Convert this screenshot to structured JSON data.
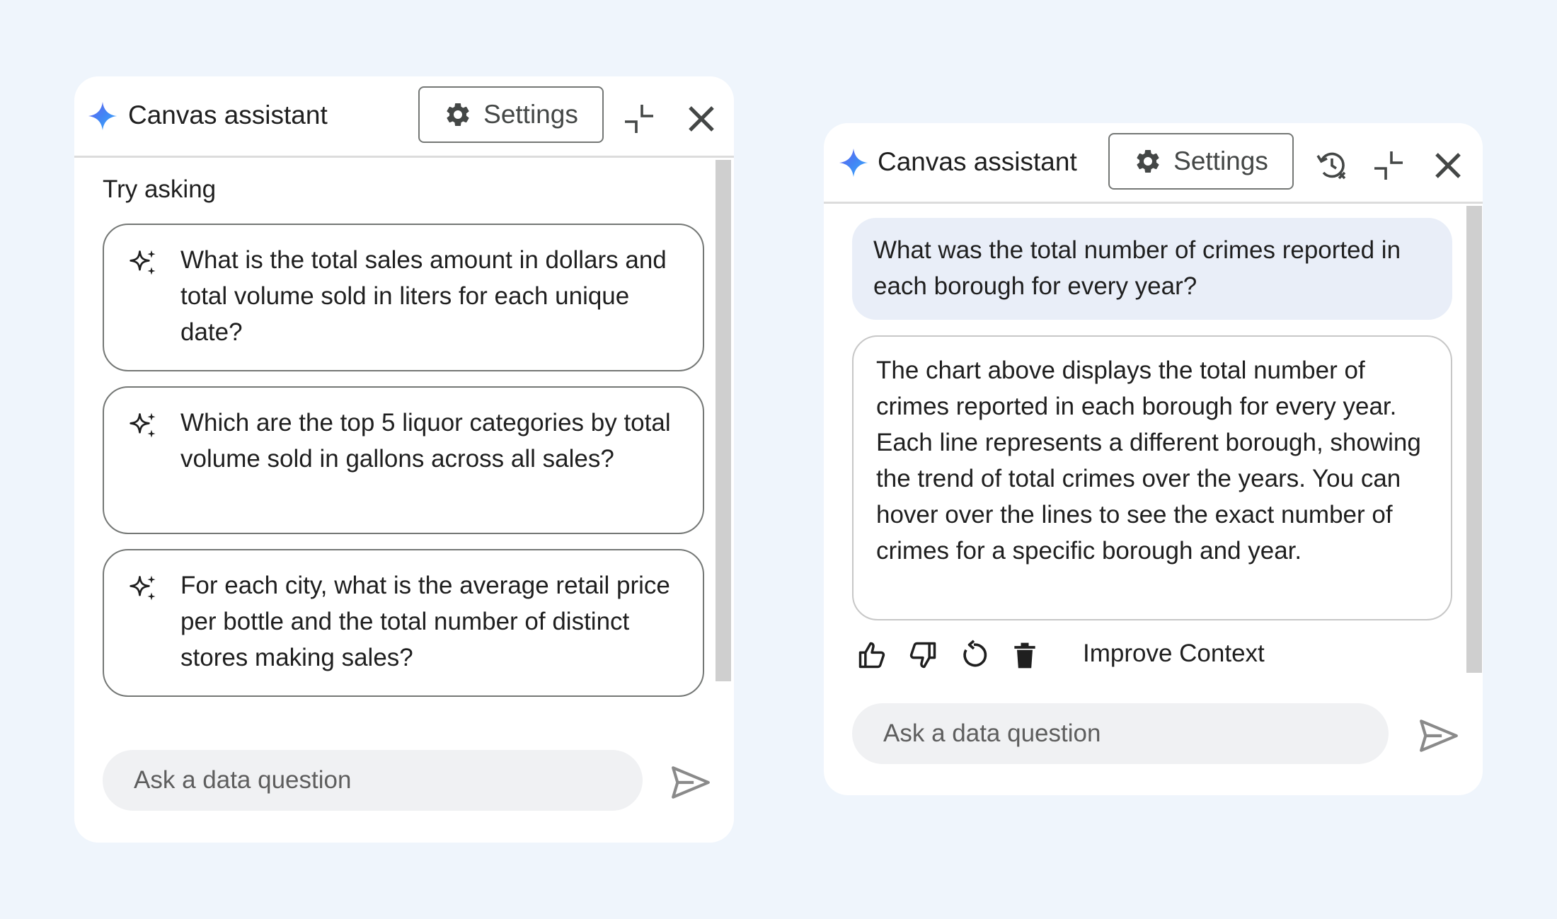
{
  "left_panel": {
    "title": "Canvas assistant",
    "settings_label": "Settings",
    "section_label": "Try asking",
    "suggestions": [
      "What is the total sales amount in dollars and total volume sold in liters for each unique date?",
      "Which are the top 5 liquor categories by total volume sold in gallons across all sales?",
      "For each city, what is the average retail price per bottle and the total number of distinct stores making sales?"
    ],
    "input_placeholder": "Ask a data question"
  },
  "right_panel": {
    "title": "Canvas assistant",
    "settings_label": "Settings",
    "user_message": "What was the total number of crimes reported in each borough for every year?",
    "assistant_reply": "The chart above displays the total number of crimes reported in each borough for every year. Each line represents a different borough, showing the trend of total crimes over the years. You can hover over the lines to see the exact number of crimes for a specific borough and year.",
    "improve_label": "Improve Context",
    "input_placeholder": "Ask a data question"
  },
  "icons": {
    "brand": "sparkle-gemini-icon",
    "settings": "gear-icon",
    "collapse": "collapse-icon",
    "close": "close-icon",
    "history": "history-clear-icon",
    "suggestion": "sparkles-icon",
    "send": "send-icon",
    "thumbs_up": "thumbs-up-icon",
    "thumbs_down": "thumbs-down-icon",
    "refresh": "refresh-icon",
    "delete": "trash-icon"
  },
  "colors": {
    "background": "#eff5fc",
    "panel": "#ffffff",
    "user_bubble": "#e9eef8",
    "input_bg": "#f0f1f3",
    "brand_blue": "#4285f4"
  }
}
